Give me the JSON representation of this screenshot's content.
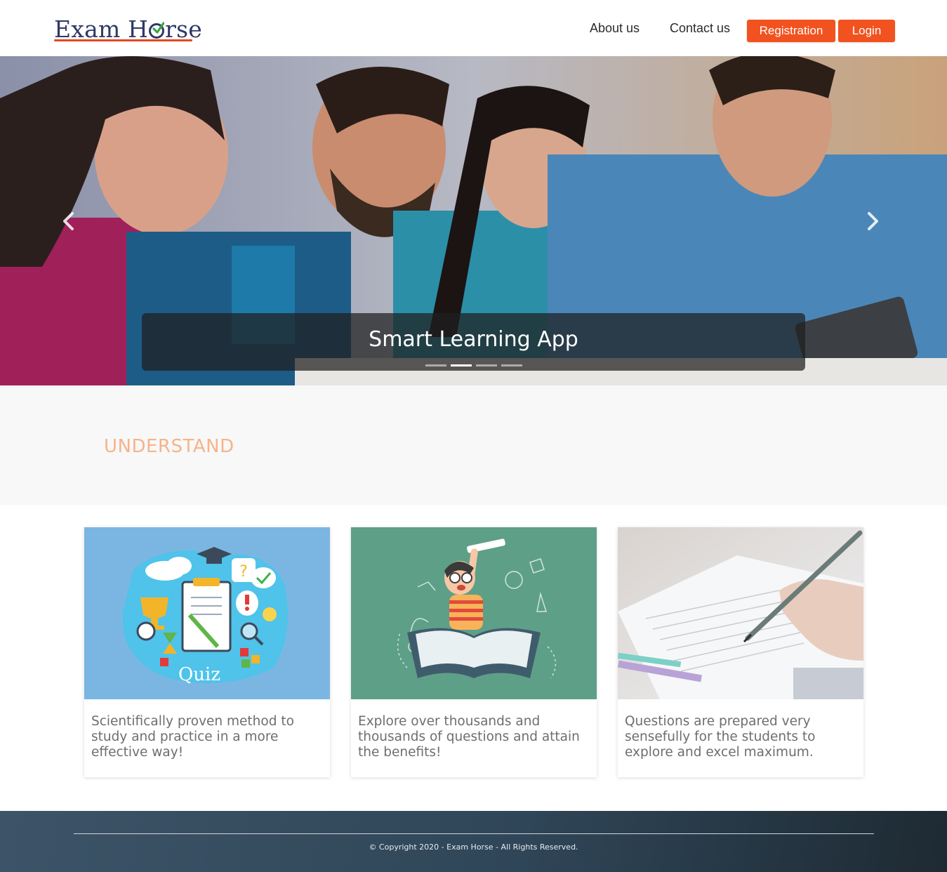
{
  "header": {
    "logo_prefix": "Exam H",
    "logo_suffix": "rse",
    "nav": {
      "about": "About us",
      "contact": "Contact us"
    },
    "buttons": {
      "registration": "Registration",
      "login": "Login"
    },
    "accent_color": "#f2521f",
    "logo_color": "#2e3a66"
  },
  "hero": {
    "caption": "Smart Learning App",
    "slides_count": 4,
    "active_slide": 2,
    "prev_icon": "chevron-left-icon",
    "next_icon": "chevron-right-icon"
  },
  "section": {
    "title": "UNDERSTAND",
    "title_color": "#f5b48a"
  },
  "cards": [
    {
      "image_label": "Quiz",
      "text": "Scientifically proven method to study and practice in a more effective way!"
    },
    {
      "text": "Explore over thousands and thousands of questions and attain the benefits!"
    },
    {
      "text": "Questions are prepared very sensefully for the students to explore and excel maximum."
    }
  ],
  "footer": {
    "copyright": "© Copyright 2020 - Exam Horse - All Rights Reserved."
  }
}
